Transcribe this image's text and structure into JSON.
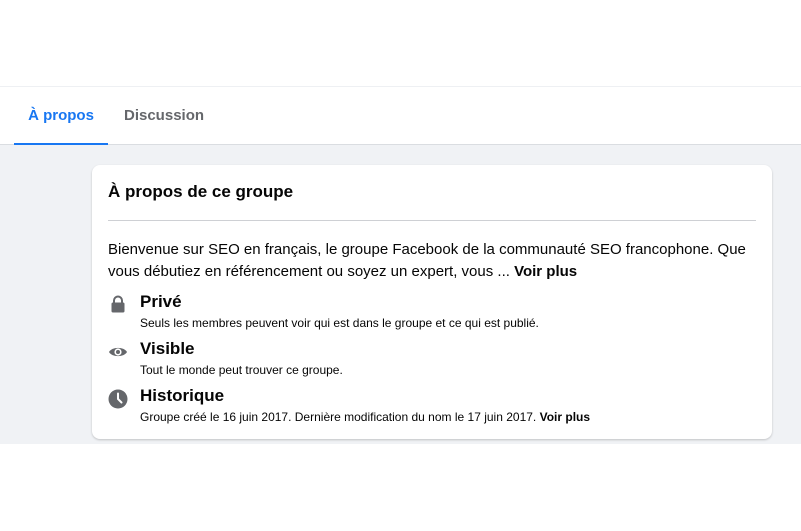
{
  "tabs": [
    {
      "label": "À propos",
      "active": true
    },
    {
      "label": "Discussion",
      "active": false
    }
  ],
  "colors": {
    "accent": "#1877f2",
    "icon": "#65676b",
    "background": "#f0f2f5"
  },
  "about": {
    "title": "À propos de ce groupe",
    "description": "Bienvenue sur SEO en français, le groupe Facebook de la communauté SEO francophone. Que vous débutiez en référencement ou soyez un expert, vous ...",
    "see_more": "Voir plus",
    "items": [
      {
        "icon": "lock-icon",
        "title": "Privé",
        "subtitle": "Seuls les membres peuvent voir qui est dans le groupe et ce qui est publié."
      },
      {
        "icon": "eye-icon",
        "title": "Visible",
        "subtitle": "Tout le monde peut trouver ce groupe."
      },
      {
        "icon": "clock-icon",
        "title": "Historique",
        "subtitle": "Groupe créé le 16 juin 2017. Dernière modification du nom le 17 juin 2017.",
        "see_more": "Voir plus"
      }
    ]
  }
}
